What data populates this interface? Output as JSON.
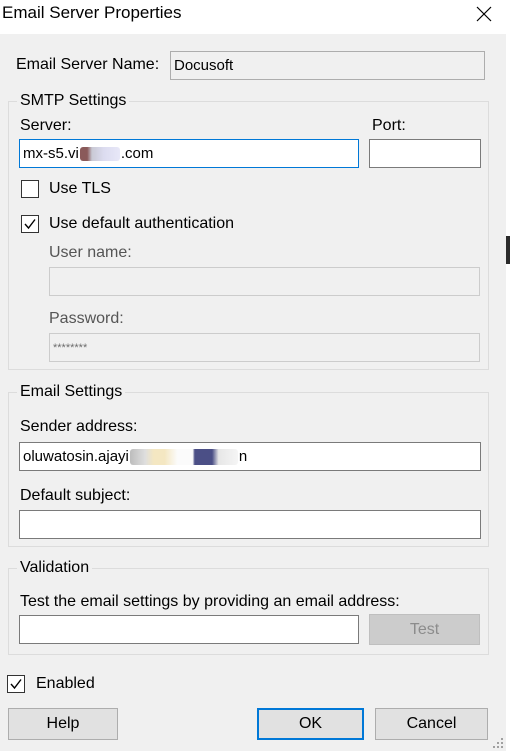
{
  "window": {
    "title": "Email Server Properties",
    "close_glyph": "✕"
  },
  "server_name": {
    "label": "Email Server Name:",
    "value": "Docusoft"
  },
  "smtp": {
    "group_title": "SMTP Settings",
    "server_label": "Server:",
    "server_value_prefix": "mx-s5.vi",
    "server_value_suffix": ".com",
    "port_label": "Port:",
    "port_value": "",
    "use_tls_label": "Use TLS",
    "use_tls_checked": false,
    "default_auth_label": "Use default authentication",
    "default_auth_checked": true,
    "username_label": "User name:",
    "username_value": "",
    "password_label": "Password:",
    "password_value": "********"
  },
  "email_settings": {
    "group_title": "Email Settings",
    "sender_label": "Sender address:",
    "sender_value_prefix": "oluwatosin.ajayi",
    "sender_value_suffix": "n",
    "subject_label": "Default subject:",
    "subject_value": ""
  },
  "validation": {
    "group_title": "Validation",
    "instruction": "Test the email settings by providing an email address:",
    "test_email_value": "",
    "test_button": "Test"
  },
  "enabled": {
    "label": "Enabled",
    "checked": true
  },
  "buttons": {
    "help": "Help",
    "ok": "OK",
    "cancel": "Cancel"
  },
  "icons": {
    "check": "checkmark-icon",
    "close": "close-icon",
    "grip": "resize-grip-icon"
  },
  "colors": {
    "focus_border": "#0078d7",
    "window_bg": "#f0f0f0"
  }
}
